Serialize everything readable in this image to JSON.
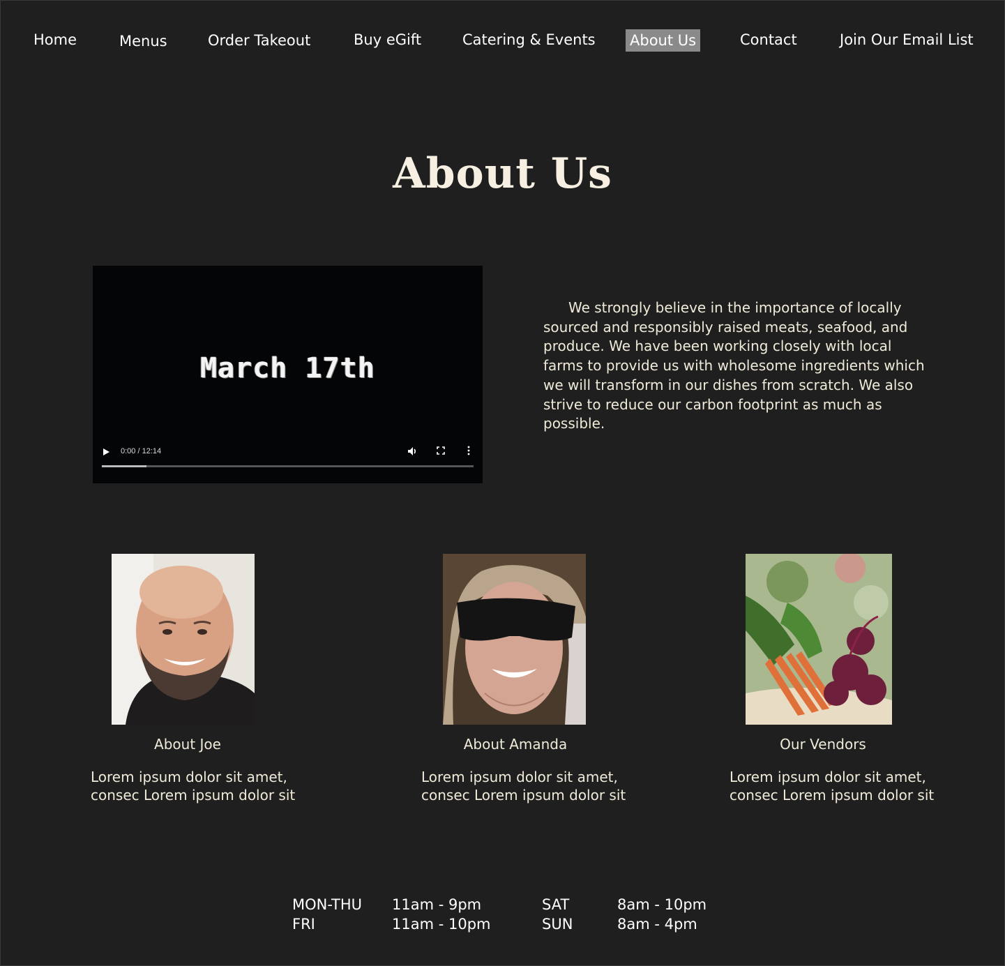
{
  "nav": {
    "items": [
      "Home",
      "Menus",
      "Order Takeout",
      "Buy eGift",
      "Catering & Events",
      "About Us",
      "Contact",
      "Join Our Email List"
    ],
    "active": "About Us"
  },
  "page_title": "About Us",
  "video": {
    "title_card": "March 17th",
    "time": "0:00 / 12:14",
    "progress": 0.12,
    "icons": [
      "play-icon",
      "volume-icon",
      "fullscreen-icon",
      "more-options-icon"
    ]
  },
  "description": "We strongly believe in the importance of locally sourced and responsibly raised meats, seafood, and produce. We have been working closely with local farms to provide us with wholesome ingredients which we will transform in our dishes from scratch. We also strive to reduce our carbon footprint as much as possible.",
  "cards": [
    {
      "heading": "About Joe",
      "text": "Lorem ipsum dolor sit amet, consec Lorem ipsum dolor sit",
      "image": "photo-joe"
    },
    {
      "heading": "About Amanda",
      "text": "Lorem ipsum dolor sit amet, consec Lorem ipsum dolor sit",
      "image": "photo-amanda"
    },
    {
      "heading": "Our Vendors",
      "text": "Lorem ipsum dolor sit amet, consec Lorem ipsum dolor sit",
      "image": "photo-vegetables"
    }
  ],
  "hours": {
    "mon_thu_label": "MON-THU",
    "mon_thu": "11am - 9pm",
    "fri_label": "FRI",
    "fri": "11am - 10pm",
    "sat_label": "SAT",
    "sat": "8am - 10pm",
    "sun_label": "SUN",
    "sun": "8am - 4pm"
  },
  "colors": {
    "background": "#1f1f1f",
    "active_nav_bg": "#8a8a8a",
    "text": "#f1ece2"
  }
}
